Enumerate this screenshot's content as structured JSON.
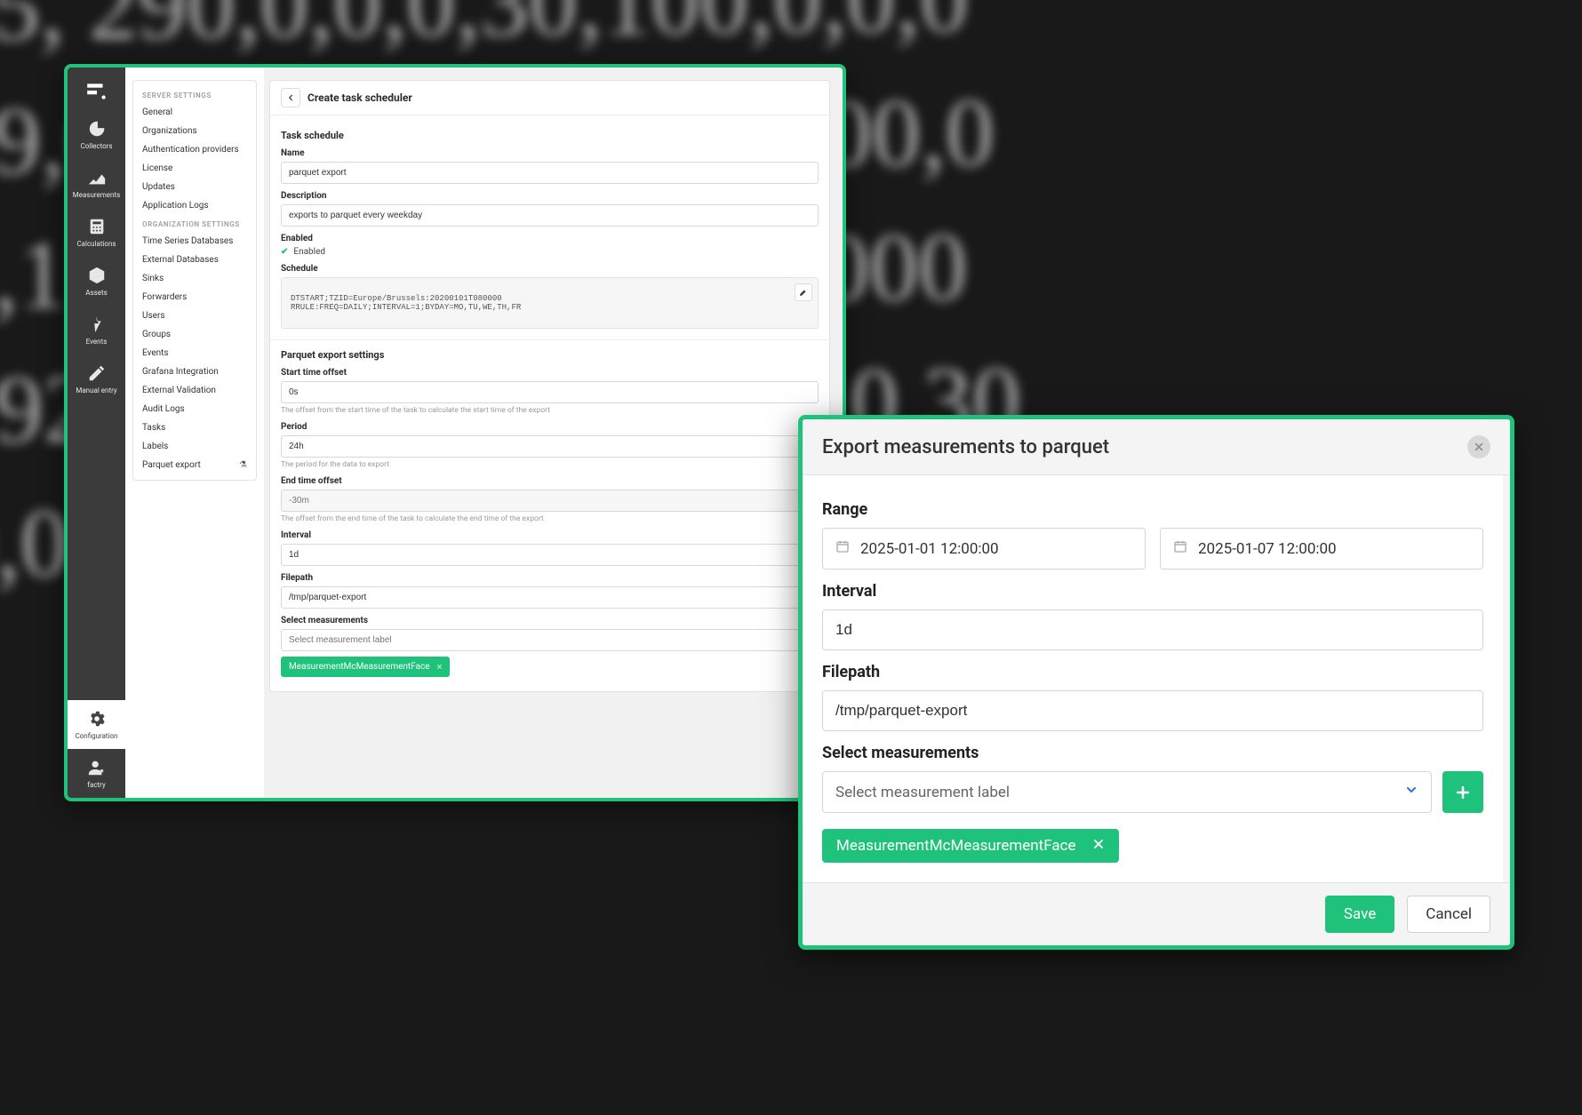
{
  "rail": {
    "items": [
      {
        "label": "Collectors"
      },
      {
        "label": "Measurements"
      },
      {
        "label": "Calculations"
      },
      {
        "label": "Assets"
      },
      {
        "label": "Events"
      },
      {
        "label": "Manual entry"
      }
    ],
    "bottom": [
      {
        "label": "Configuration"
      },
      {
        "label": "factry"
      }
    ]
  },
  "settings": {
    "server_title": "SERVER SETTINGS",
    "server_items": [
      "General",
      "Organizations",
      "Authentication providers",
      "License",
      "Updates",
      "Application Logs"
    ],
    "org_title": "ORGANIZATION SETTINGS",
    "org_items": [
      "Time Series Databases",
      "External Databases",
      "Sinks",
      "Forwarders",
      "Users",
      "Groups",
      "Events",
      "Grafana Integration",
      "External Validation",
      "Audit Logs",
      "Tasks",
      "Labels",
      "Parquet export"
    ]
  },
  "scheduler": {
    "title": "Create task scheduler",
    "section_task": "Task schedule",
    "labels": {
      "name": "Name",
      "description": "Description",
      "enabled": "Enabled",
      "schedule": "Schedule"
    },
    "values": {
      "name": "parquet export",
      "description": "exports to parquet every weekday",
      "enabled_text": "Enabled",
      "schedule_code": "DTSTART;TZID=Europe/Brussels:20200101T080000\nRRULE:FREQ=DAILY;INTERVAL=1;BYDAY=MO,TU,WE,TH,FR"
    },
    "section_parquet": "Parquet export settings",
    "parquet_labels": {
      "start_offset": "Start time offset",
      "period": "Period",
      "end_offset": "End time offset",
      "interval": "Interval",
      "filepath": "Filepath",
      "select_measurements": "Select measurements"
    },
    "parquet_values": {
      "start_offset": "0s",
      "period": "24h",
      "end_offset_placeholder": "-30m",
      "interval": "1d",
      "filepath": "/tmp/parquet-export",
      "select_placeholder": "Select measurement label"
    },
    "hints": {
      "start_offset": "The offset from the start time of the task to calculate the start time of the export",
      "period": "The period for the data to export",
      "end_offset": "The offset from the end time of the task to calculate the end time of the export"
    },
    "tag": "MeasurementMcMeasurementFace"
  },
  "modal": {
    "title": "Export measurements to parquet",
    "labels": {
      "range": "Range",
      "interval": "Interval",
      "filepath": "Filepath",
      "select": "Select measurements"
    },
    "range_from": "2025-01-01 12:00:00",
    "range_to": "2025-01-07 12:00:00",
    "interval": "1d",
    "filepath": "/tmp/parquet-export",
    "select_placeholder": "Select measurement label",
    "tag": "MeasurementMcMeasurementFace",
    "save": "Save",
    "cancel": "Cancel"
  }
}
